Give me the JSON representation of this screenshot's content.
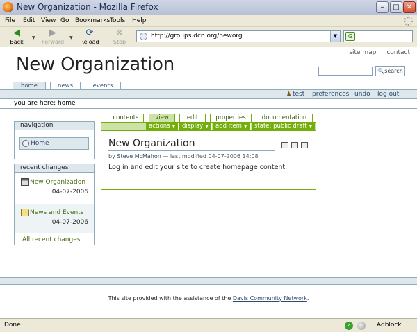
{
  "window": {
    "title": "New Organization - Mozilla Firefox"
  },
  "menu": {
    "items": [
      "File",
      "Edit",
      "View",
      "Go",
      "Bookmarks",
      "Tools",
      "Help"
    ]
  },
  "nav": {
    "back": "Back",
    "forward": "Forward",
    "reload": "Reload",
    "stop": "Stop",
    "url": "http://groups.dcn.org/neworg"
  },
  "site": {
    "links": [
      "site map",
      "contact"
    ],
    "heading": "New Organization",
    "search_button": "search",
    "portal_tabs": [
      "home",
      "news",
      "events"
    ],
    "personal": {
      "user": "test",
      "preferences": "preferences",
      "undo": "undo",
      "logout": "log out"
    },
    "breadcrumb": "you are here: home"
  },
  "navigation_portlet": {
    "header": "navigation",
    "items": [
      "Home"
    ]
  },
  "recent_portlet": {
    "header": "recent changes",
    "items": [
      {
        "title": "New Organization",
        "date": "04-07-2006",
        "icon": "document-icon"
      },
      {
        "title": "News and Events",
        "date": "04-07-2006",
        "icon": "folder-icon"
      }
    ],
    "all_link": "All recent changes..."
  },
  "content": {
    "tabs": [
      "contents",
      "view",
      "edit",
      "properties",
      "documentation"
    ],
    "active_tab": "view",
    "actions": [
      "actions",
      "display",
      "add item",
      "state: public draft"
    ],
    "title": "New Organization",
    "byline_prefix": "by",
    "author": "Steve McMahon",
    "byline_suffix": "— last modified 04-07-2006 14:08",
    "body": "Log in and edit your site to create homepage content."
  },
  "footer": {
    "text_before": "This site provided with the assistance of the",
    "link": "Davis Community Network",
    "text_after": "."
  },
  "status": {
    "text": "Done",
    "adblock": "Adblock"
  },
  "colors": {
    "plone_blue": "#8cacbb",
    "plone_light": "#dee7ec",
    "plone_green": "#74ae0b",
    "plone_green_light": "#cde2a7"
  }
}
